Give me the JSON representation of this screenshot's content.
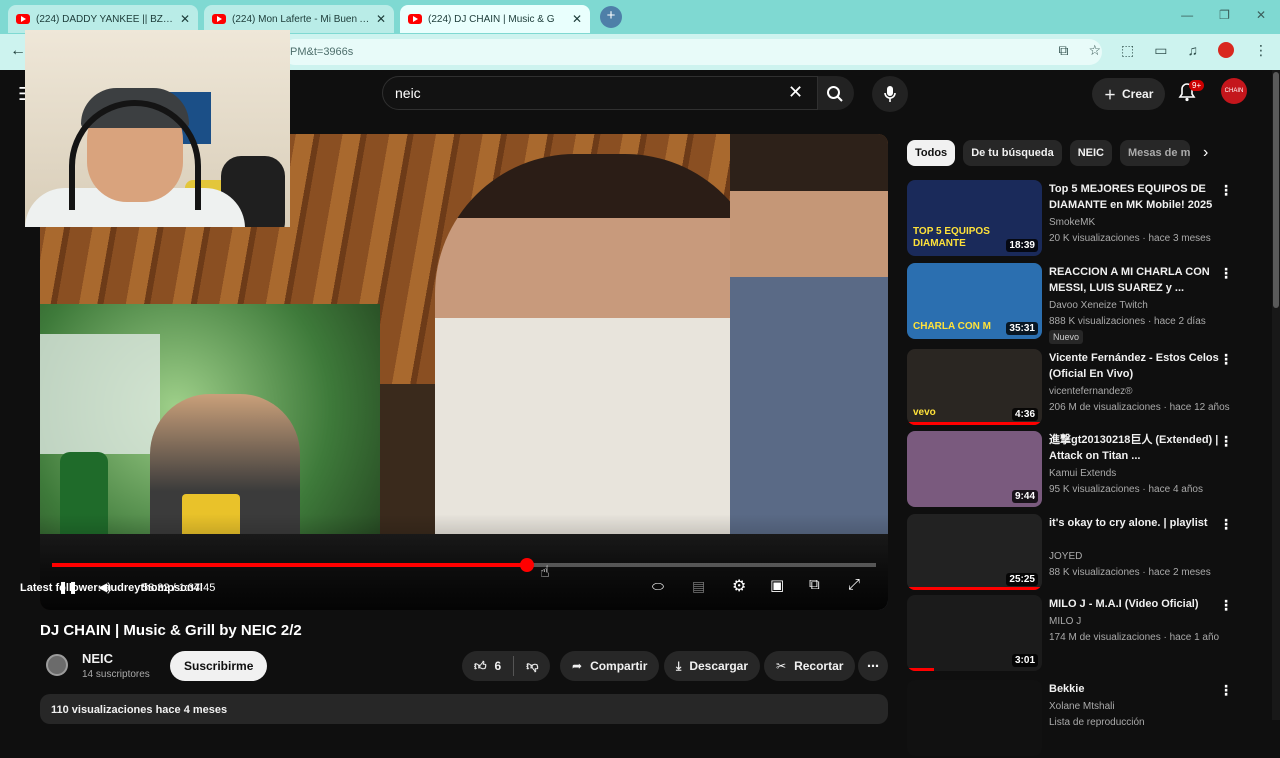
{
  "browser": {
    "tabs": [
      {
        "title": "(224) DADDY YANKEE || BZRP M",
        "active": false
      },
      {
        "title": "(224) Mon Laferte - Mi Buen Am",
        "active": false
      },
      {
        "title": "(224) DJ CHAIN | Music & G",
        "active": true
      }
    ],
    "address": "PM&t=3966s"
  },
  "header": {
    "search_value": "neic",
    "create_label": "Crear",
    "notif_count": "9+",
    "avatar_text": "CHAIN"
  },
  "player": {
    "progress": 0.576,
    "time": "58:32 / 1:37:45",
    "overlay_text": "Latest follower: audreythompson4l"
  },
  "video": {
    "title": "DJ CHAIN | Music & Grill by NEIC 2/2",
    "channel": "NEIC",
    "subscribers": "14 suscriptores",
    "subscribe_label": "Suscribirme",
    "likes": "6",
    "share_label": "Compartir",
    "download_label": "Descargar",
    "clip_label": "Recortar",
    "description": "110 visualizaciones  hace 4 meses"
  },
  "chips": [
    "Todos",
    "De tu búsqueda",
    "NEIC",
    "Mesas de m"
  ],
  "recommendations": [
    {
      "title": "Top 5 MEJORES EQUIPOS DE DIAMANTE en MK Mobile! 2025",
      "channel": "SmokeMK",
      "meta": "20 K visualizaciones · hace 3 meses",
      "duration": "18:39",
      "thumb": "#1a2a5a",
      "thumb_text": "TOP 5 EQUIPOS DIAMANTE"
    },
    {
      "title": "REACCION A MI CHARLA CON MESSI, LUIS SUAREZ y ...",
      "channel": "Davoo Xeneize Twitch",
      "meta": "888 K visualizaciones · hace 2 días",
      "duration": "35:31",
      "badge": "Nuevo",
      "thumb": "#2b6fb0",
      "thumb_text": "CHARLA CON M"
    },
    {
      "title": "Vicente Fernández - Estos Celos (Oficial En Vivo)",
      "channel": "vicentefernandez®",
      "meta": "206 M de visualizaciones · hace 12 años",
      "duration": "4:36",
      "thumb": "#2a2622",
      "thumb_text": "vevo"
    },
    {
      "title": "進撃gt20130218巨人 (Extended) | Attack on Titan ...",
      "channel": "Kamui Extends",
      "meta": "95 K visualizaciones · hace 4 años",
      "duration": "9:44",
      "thumb": "#7a5a7e",
      "thumb_text": ""
    },
    {
      "title": "it's okay to cry alone. | playlist",
      "channel": "JOYED",
      "meta": "88 K visualizaciones · hace 2 meses",
      "duration": "25:25",
      "thumb": "#222222",
      "thumb_text": ""
    },
    {
      "title": "MILO J - M.A.I (Video Oficial)",
      "channel": "MILO J",
      "meta": "174 M de visualizaciones · hace 1 año",
      "duration": "3:01",
      "thumb": "#1b1b1b",
      "thumb_text": ""
    },
    {
      "title": "Bekkie",
      "channel": "Xolane Mtshali",
      "meta": "Lista de reproducción",
      "duration": "",
      "thumb": "#111111",
      "thumb_text": ""
    }
  ]
}
